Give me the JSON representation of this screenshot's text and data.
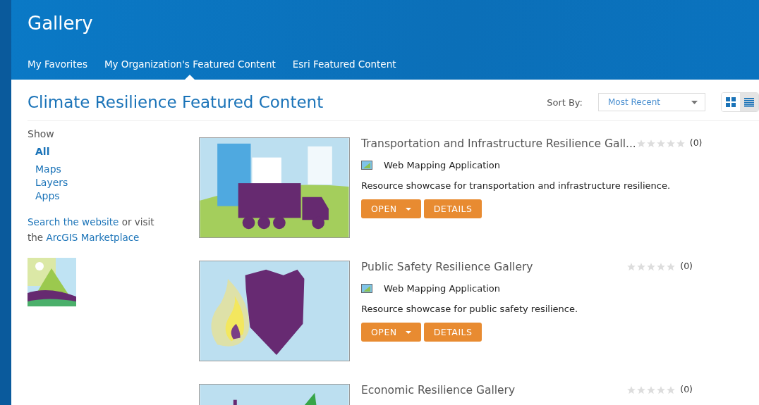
{
  "header": {
    "title": "Gallery",
    "tabs": [
      {
        "label": "My Favorites",
        "selected": false
      },
      {
        "label": "My Organization's Featured Content",
        "selected": true
      },
      {
        "label": "Esri Featured Content",
        "selected": false
      }
    ]
  },
  "page_title": "Climate Resilience Featured Content",
  "sort": {
    "label": "Sort By:",
    "value": "Most Recent"
  },
  "view_toggle": [
    {
      "kind": "grid",
      "selected": false
    },
    {
      "kind": "list",
      "selected": true
    }
  ],
  "sidebar": {
    "heading": "Show",
    "filters": [
      {
        "label": "All",
        "selected": true
      },
      {
        "label": "Maps",
        "selected": false
      },
      {
        "label": "Layers",
        "selected": false
      },
      {
        "label": "Apps",
        "selected": false
      }
    ],
    "note": {
      "link1": "Search the website",
      "mid": "or visit",
      "pre": "the",
      "link2": "ArcGIS Marketplace"
    }
  },
  "items": [
    {
      "kind": "transport",
      "title": "Transportation and Infrastructure Resilience Gall...",
      "stars": 0,
      "count": "(0)",
      "type": "Web Mapping Application",
      "description": "Resource showcase for transportation and infrastructure resilience.",
      "buttons": [
        "OPEN",
        "DETAILS"
      ]
    },
    {
      "kind": "safety",
      "title": "Public Safety Resilience Gallery",
      "stars": 0,
      "count": "(0)",
      "type": "Web Mapping Application",
      "description": "Resource showcase for public safety resilience.",
      "buttons": [
        "OPEN",
        "DETAILS"
      ]
    },
    {
      "kind": "economic",
      "title": "Economic Resilience Gallery",
      "stars": 0,
      "count": "(0)"
    }
  ]
}
